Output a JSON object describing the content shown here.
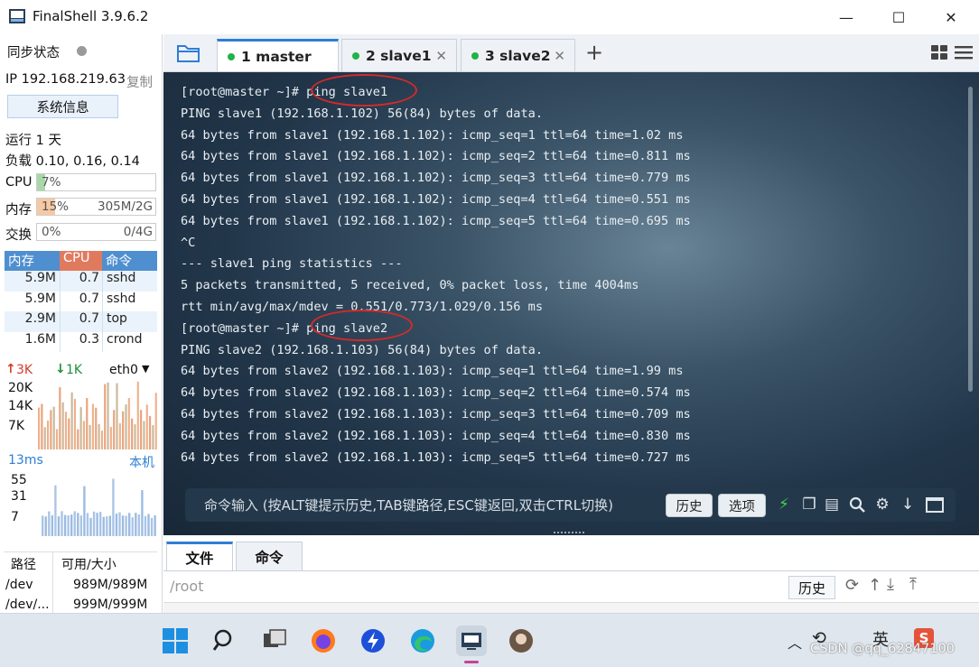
{
  "window": {
    "title": "FinalShell 3.9.6.2",
    "controls": {
      "minimize": "—",
      "maximize": "☐",
      "close": "✕"
    }
  },
  "sidebar": {
    "sync_status_label": "同步状态",
    "ip_label": "IP 192.168.219.63",
    "copy_label": "复制",
    "sysinfo_button": "系统信息",
    "uptime": "运行 1 天",
    "load": "负载 0.10, 0.16, 0.14",
    "cpu": {
      "label": "CPU",
      "percent_text": "7%",
      "fraction": 0.07
    },
    "memory": {
      "label": "内存",
      "percent_text": "15%",
      "size_text": "305M/2G",
      "fraction": 0.15
    },
    "swap": {
      "label": "交换",
      "percent_text": "0%",
      "size_text": "0/4G",
      "fraction": 0.0
    },
    "process_table": {
      "headers": [
        "内存",
        "CPU",
        "命令"
      ],
      "rows": [
        {
          "mem": "5.9M",
          "cpu": "0.7",
          "cmd": "sshd"
        },
        {
          "mem": "5.9M",
          "cpu": "0.7",
          "cmd": "sshd"
        },
        {
          "mem": "2.9M",
          "cpu": "0.7",
          "cmd": "top"
        },
        {
          "mem": "1.6M",
          "cpu": "0.3",
          "cmd": "crond"
        }
      ]
    },
    "network": {
      "up": "3K",
      "down": "1K",
      "interface": "eth0",
      "y_ticks": [
        "20K",
        "14K",
        "7K"
      ]
    },
    "latency": {
      "value": "13ms",
      "target": "本机",
      "y_ticks": [
        "55",
        "31",
        "7"
      ]
    },
    "disk": {
      "headers": [
        "路径",
        "可用/大小"
      ],
      "rows": [
        {
          "path": "/dev",
          "size": "989M/989M"
        },
        {
          "path": "/dev/...",
          "size": "999M/999M"
        }
      ]
    }
  },
  "tabs": [
    {
      "label": "1 master",
      "active": true
    },
    {
      "label": "2 slave1",
      "active": false
    },
    {
      "label": "3 slave2",
      "active": false
    }
  ],
  "terminal": {
    "lines": [
      "[root@master ~]# ping slave1",
      "PING slave1 (192.168.1.102) 56(84) bytes of data.",
      "64 bytes from slave1 (192.168.1.102): icmp_seq=1 ttl=64 time=1.02 ms",
      "64 bytes from slave1 (192.168.1.102): icmp_seq=2 ttl=64 time=0.811 ms",
      "64 bytes from slave1 (192.168.1.102): icmp_seq=3 ttl=64 time=0.779 ms",
      "64 bytes from slave1 (192.168.1.102): icmp_seq=4 ttl=64 time=0.551 ms",
      "64 bytes from slave1 (192.168.1.102): icmp_seq=5 ttl=64 time=0.695 ms",
      "^C",
      "--- slave1 ping statistics ---",
      "5 packets transmitted, 5 received, 0% packet loss, time 4004ms",
      "rtt min/avg/max/mdev = 0.551/0.773/1.029/0.156 ms",
      "[root@master ~]# ping slave2",
      "PING slave2 (192.168.1.103) 56(84) bytes of data.",
      "64 bytes from slave2 (192.168.1.103): icmp_seq=1 ttl=64 time=1.99 ms",
      "64 bytes from slave2 (192.168.1.103): icmp_seq=2 ttl=64 time=0.574 ms",
      "64 bytes from slave2 (192.168.1.103): icmp_seq=3 ttl=64 time=0.709 ms",
      "64 bytes from slave2 (192.168.1.103): icmp_seq=4 ttl=64 time=0.830 ms",
      "64 bytes from slave2 (192.168.1.103): icmp_seq=5 ttl=64 time=0.727 ms"
    ],
    "command_placeholder": "命令输入 (按ALT键提示历史,TAB键路径,ESC键返回,双击CTRL切换)",
    "history_button": "历史",
    "options_button": "选项"
  },
  "file_panel": {
    "tabs": [
      "文件",
      "命令"
    ],
    "path": "/root",
    "history_button": "历史"
  },
  "taskbar": {
    "ime": "英",
    "watermark": "CSDN @qq_62847100"
  },
  "colors": {
    "accent": "#2d7fd4",
    "status_dot": "#21b24a",
    "table_header": "#4f8fd0",
    "table_header_active": "#e07a5f",
    "annotation_ring": "#d42a2a"
  }
}
